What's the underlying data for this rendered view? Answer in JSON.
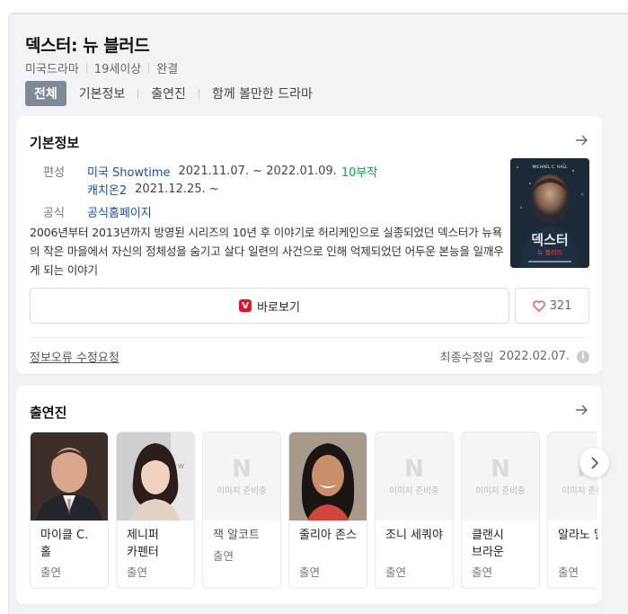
{
  "title": "덱스터: 뉴 블러드",
  "meta": [
    "미국드라마",
    "19세이상",
    "완결"
  ],
  "tabs": [
    "전체",
    "기본정보",
    "출연진",
    "함께 볼만한 드라마"
  ],
  "basic": {
    "heading": "기본정보",
    "rows": [
      {
        "label": "편성",
        "link": "미국 Showtime",
        "text": "2021.11.07. ~ 2022.01.09.",
        "episodes": "10부작"
      },
      {
        "label": "",
        "link": "캐치온2",
        "text": "2021.12.25. ~",
        "episodes": ""
      },
      {
        "label": "공식",
        "link": "공식홈페이지",
        "text": "",
        "episodes": ""
      }
    ],
    "description": "2006년부터 2013년까지 방영된 시리즈의 10년 후 이야기로 허리케인으로 실종되었던 덱스터가 뉴욕의 작은 마을에서 자신의 정체성을 숨기고 살다 일련의 사건으로 인해 억제되었던 어두운 본능을 일깨우게 되는 이야기",
    "poster_title": "덱스터",
    "poster_subtitle": "뉴 블러드",
    "watch_label": "바로보기",
    "tving_mark": "V",
    "likes": "321",
    "report_label": "정보오류 수정요청",
    "updated_label": "최종수정일",
    "updated_date": "2022.02.07."
  },
  "cast": {
    "heading": "출연진",
    "placeholder_N": "N",
    "placeholder_text": "이미지 준비중",
    "people": [
      {
        "name": "마이클 C. 홀",
        "role": "출연",
        "photo": "man-suit"
      },
      {
        "name": "제니퍼 카펜터",
        "role": "출연",
        "photo": "woman-dark-hair"
      },
      {
        "name": "잭 알코트",
        "role": "출연",
        "photo": "none"
      },
      {
        "name": "줄리아 존스",
        "role": "출연",
        "photo": "woman-smiling"
      },
      {
        "name": "조니 세쿼야",
        "role": "출연",
        "photo": "none"
      },
      {
        "name": "클랜시 브라운",
        "role": "출연",
        "photo": "none"
      },
      {
        "name": "알라노 밀러",
        "role": "출연",
        "photo": "none"
      }
    ]
  },
  "colors": {
    "link": "#1a4fa8",
    "episodes": "#1aa14b",
    "active_tab": "#808a97",
    "tving": "#e8112d"
  }
}
